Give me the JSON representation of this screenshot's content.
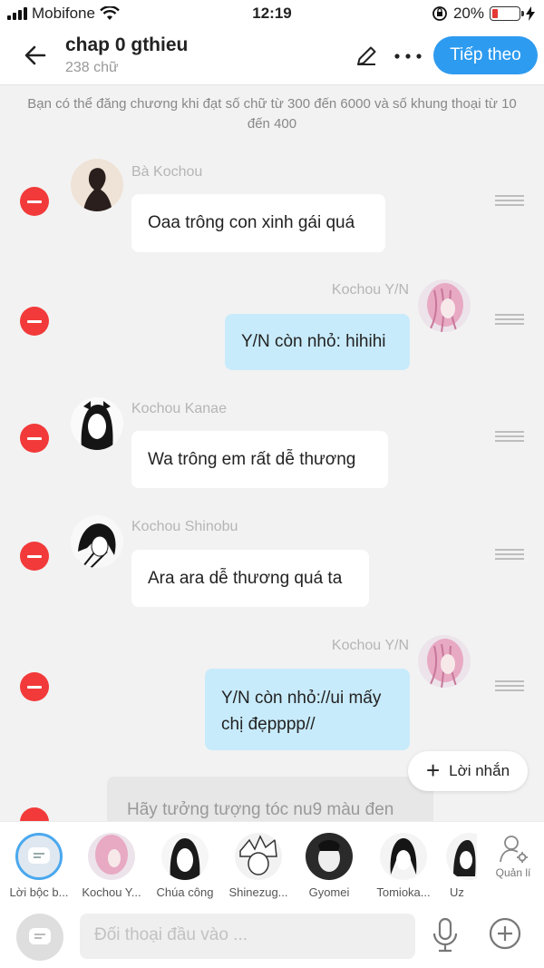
{
  "status_bar": {
    "carrier": "Mobifone",
    "time": "12:19",
    "battery": "20%",
    "battery_level": 0.2
  },
  "header": {
    "title": "chap 0 gthieu",
    "word_count": "238 chữ",
    "next_label": "Tiếp theo"
  },
  "notice": "Bạn có thể đăng chương khi đạt số chữ từ 300 đến 6000 và số khung thoại từ 10 đến 400",
  "messages": [
    {
      "name": "Bà Kochou",
      "text": "Oaa trông con xinh gái quá",
      "side": "left"
    },
    {
      "name": "Kochou Y/N",
      "text": "Y/N còn nhỏ: hihihi",
      "side": "right"
    },
    {
      "name": "Kochou Kanae",
      "text": "Wa trông em rất dễ thương",
      "side": "left"
    },
    {
      "name": "Kochou Shinobu",
      "text": "Ara ara dễ thương quá ta",
      "side": "left"
    },
    {
      "name": "Kochou Y/N",
      "text": "Y/N còn nhỏ://ui mấy chị đẹpppp//",
      "side": "right"
    }
  ],
  "add_message_label": "Lời nhắn",
  "narration_preview": "Hãy tưởng tượng tóc nu9 màu đen",
  "characters": [
    {
      "label": "Lời bộc b..."
    },
    {
      "label": "Kochou Y..."
    },
    {
      "label": "Chúa công"
    },
    {
      "label": "Shinezug..."
    },
    {
      "label": "Gyomei"
    },
    {
      "label": "Tomioka..."
    },
    {
      "label": "Uz"
    }
  ],
  "manage_label": "Quản lí",
  "input": {
    "placeholder": "Đối thoại đầu vào ..."
  },
  "colors": {
    "accent": "#2d9bf0",
    "delete": "#f23a3a",
    "right_bubble": "#c8ebfb",
    "battery_low": "#e53935"
  }
}
